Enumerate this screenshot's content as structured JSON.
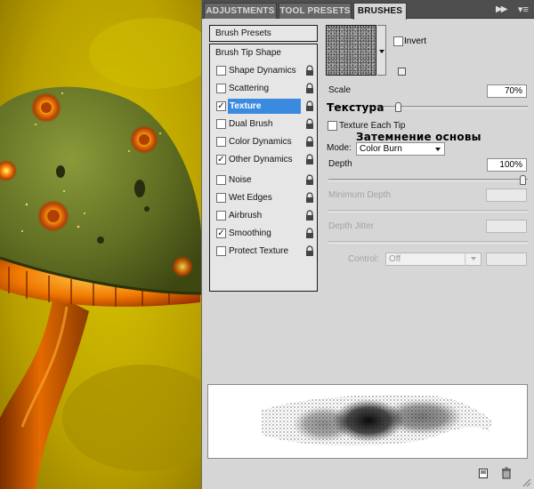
{
  "tabs": [
    {
      "label": "ADJUSTMENTS",
      "active": false
    },
    {
      "label": "TOOL PRESETS",
      "active": false
    },
    {
      "label": "BRUSHES",
      "active": true
    }
  ],
  "panel_controls": {
    "collapse_icon": "double-chevron-right-icon",
    "menu_icon": "panel-menu-icon"
  },
  "sidebar": {
    "presets_label": "Brush Presets",
    "tip_shape_label": "Brush Tip Shape",
    "items": [
      {
        "label": "Shape Dynamics",
        "checked": false,
        "selected": false
      },
      {
        "label": "Scattering",
        "checked": false,
        "selected": false
      },
      {
        "label": "Texture",
        "checked": true,
        "selected": true
      },
      {
        "label": "Dual Brush",
        "checked": false,
        "selected": false
      },
      {
        "label": "Color Dynamics",
        "checked": false,
        "selected": false
      },
      {
        "label": "Other Dynamics",
        "checked": true,
        "selected": false
      },
      {
        "label": "Noise",
        "checked": false,
        "selected": false
      },
      {
        "label": "Wet Edges",
        "checked": false,
        "selected": false
      },
      {
        "label": "Airbrush",
        "checked": false,
        "selected": false
      },
      {
        "label": "Smoothing",
        "checked": true,
        "selected": false
      },
      {
        "label": "Protect Texture",
        "checked": false,
        "selected": false
      }
    ]
  },
  "texture": {
    "invert_label": "Invert",
    "invert_checked": false,
    "scale_label": "Scale",
    "scale_value": "70%",
    "scale_level": 0.35,
    "texture_each_tip_label": "Texture Each Tip",
    "texture_each_tip_checked": false,
    "mode_label": "Mode:",
    "mode_value": "Color Burn",
    "depth_label": "Depth",
    "depth_value": "100%",
    "depth_level": 1.0,
    "min_depth_label": "Minimum Depth",
    "min_depth_value": "",
    "depth_jitter_label": "Depth Jitter",
    "depth_jitter_value": "",
    "control_label": "Control:",
    "control_value": "Off",
    "control_extra_value": ""
  },
  "annotations": {
    "texture_ru": "Текстура",
    "base_burn_ru": "Затемнение основы"
  },
  "bottom_bar": {
    "new_icon": "new-preset-icon",
    "delete_icon": "trash-icon"
  },
  "colors": {
    "selection": "#3a8be0",
    "panel_bg": "#d6d6d6",
    "tabbar_bg": "#4e4e4e"
  }
}
